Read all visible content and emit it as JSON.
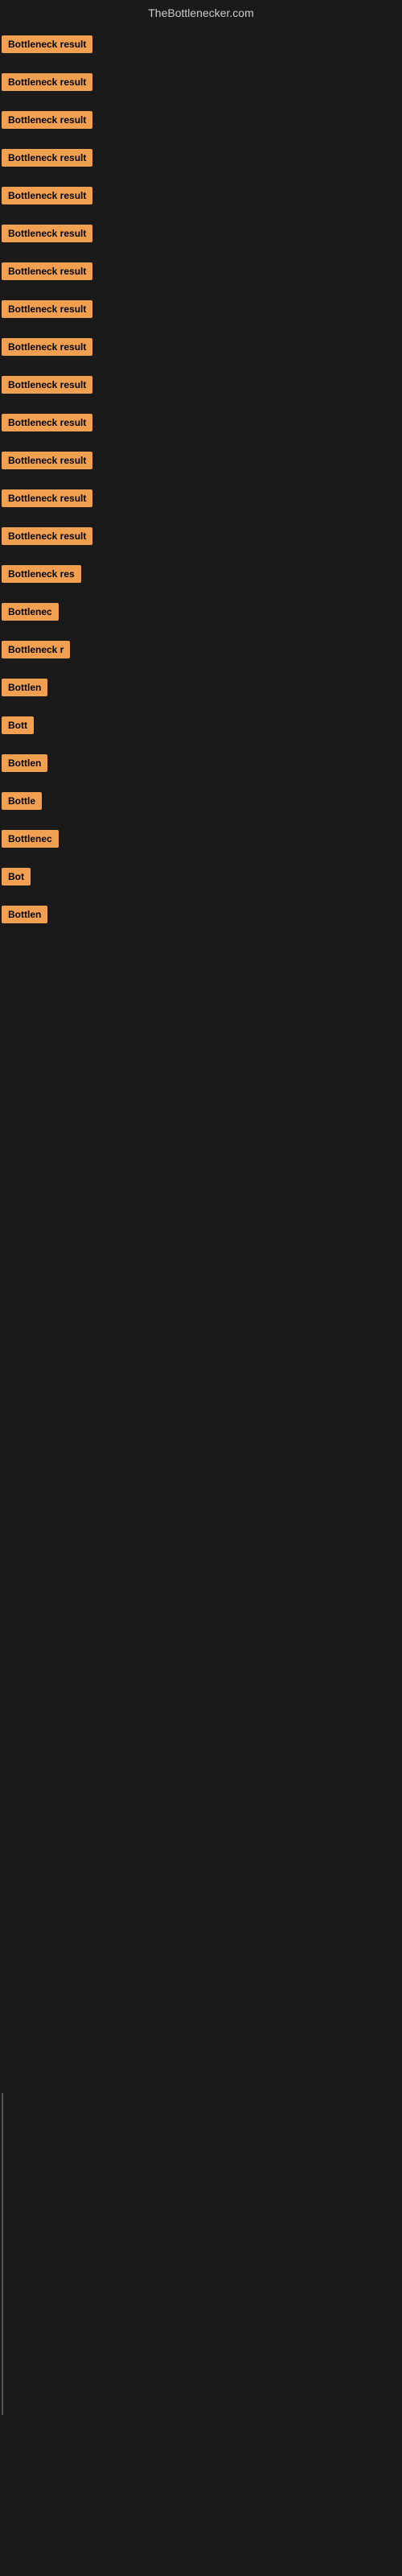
{
  "site": {
    "title": "TheBottlenecker.com"
  },
  "items": [
    {
      "id": 1,
      "label": "Bottleneck result",
      "width": "full"
    },
    {
      "id": 2,
      "label": "Bottleneck result",
      "width": "full"
    },
    {
      "id": 3,
      "label": "Bottleneck result",
      "width": "full"
    },
    {
      "id": 4,
      "label": "Bottleneck result",
      "width": "full"
    },
    {
      "id": 5,
      "label": "Bottleneck result",
      "width": "full"
    },
    {
      "id": 6,
      "label": "Bottleneck result",
      "width": "full"
    },
    {
      "id": 7,
      "label": "Bottleneck result",
      "width": "full"
    },
    {
      "id": 8,
      "label": "Bottleneck result",
      "width": "full"
    },
    {
      "id": 9,
      "label": "Bottleneck result",
      "width": "full"
    },
    {
      "id": 10,
      "label": "Bottleneck result",
      "width": "full"
    },
    {
      "id": 11,
      "label": "Bottleneck result",
      "width": "full"
    },
    {
      "id": 12,
      "label": "Bottleneck result",
      "width": "full"
    },
    {
      "id": 13,
      "label": "Bottleneck result",
      "width": "full"
    },
    {
      "id": 14,
      "label": "Bottleneck result",
      "width": "full"
    },
    {
      "id": 15,
      "label": "Bottleneck res",
      "width": "partial1"
    },
    {
      "id": 16,
      "label": "Bottlenec",
      "width": "partial2"
    },
    {
      "id": 17,
      "label": "Bottleneck r",
      "width": "partial3"
    },
    {
      "id": 18,
      "label": "Bottlen",
      "width": "partial4"
    },
    {
      "id": 19,
      "label": "Bott",
      "width": "partial5"
    },
    {
      "id": 20,
      "label": "Bottlen",
      "width": "partial4"
    },
    {
      "id": 21,
      "label": "Bottle",
      "width": "partial6"
    },
    {
      "id": 22,
      "label": "Bottlenec",
      "width": "partial2"
    },
    {
      "id": 23,
      "label": "Bot",
      "width": "partial7"
    },
    {
      "id": 24,
      "label": "Bottlen",
      "width": "partial4"
    }
  ],
  "badge": {
    "background_color": "#f0a050",
    "text_color": "#000000"
  }
}
